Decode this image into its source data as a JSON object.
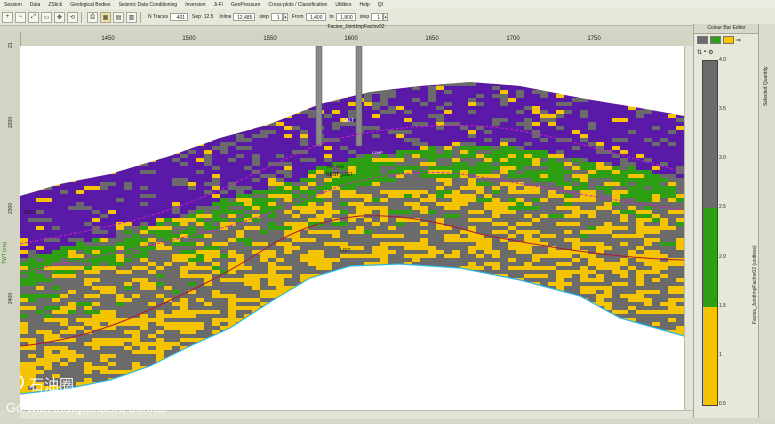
{
  "menu": [
    "Session",
    "Data",
    "ZStick",
    "Geological Bodies",
    "Seismic Data Conditioning",
    "Inversion",
    "Ji-Fi",
    "GeoPressure",
    "Cross-plots / Classification",
    "Utilities",
    "Help",
    "QI"
  ],
  "toolbar": {
    "mode_label": "N Traces",
    "traces_value": "401",
    "sep_label": "Sep: 12.5",
    "inline_label": "Inline",
    "inline_value": "12,485",
    "step_label1": "step",
    "step_value1": "1",
    "from_label": "From",
    "from_value": "1,400",
    "to_label": "to",
    "to_value": "1,800",
    "step_label2": "step",
    "step_value2": "1"
  },
  "plot": {
    "title": "Facies_JointImpFacInv02",
    "x_ticks": [
      "1450",
      "1500",
      "1550",
      "1600",
      "1650",
      "1700",
      "1750"
    ],
    "y_ticks": [
      "21",
      "2200",
      "2300",
      "2400"
    ],
    "y_axis_title": "TWT (ms)",
    "annotations": {
      "salt": "SALT",
      "rest_list": "REST_LIST",
      "l2wp": "L2WP",
      "top_rest": "TOP_RST",
      "list": "LIST",
      "selt": "SELT"
    }
  },
  "colour_bar": {
    "panel_title": "Colour Bar Editor",
    "label": "Facies_JointImpFacInv02 (unitless)",
    "ticks": [
      "4.0",
      "3.5",
      "3.0",
      "2.5",
      "2.0",
      "1.5",
      "1",
      "0.5"
    ],
    "segments": [
      {
        "from": 2.5,
        "to": 4.0,
        "color": "#6b6b6b"
      },
      {
        "from": 1.5,
        "to": 2.5,
        "color": "#2e9e12"
      },
      {
        "from": 0.5,
        "to": 1.5,
        "color": "#f5c400"
      }
    ],
    "min": 0.5,
    "max": 4.0
  },
  "side_tab": "Selected Quantity",
  "colors": {
    "salt": "#5a1aa8",
    "shale": "#6b6b6b",
    "green": "#2e9e12",
    "sand": "#f5c400",
    "horizon_magenta": "#d020c8",
    "horizon_red": "#b01830",
    "horizon_cyan": "#28b8e8"
  },
  "watermark": {
    "cn": "石油圈",
    "en": "Go with independent thinker"
  }
}
